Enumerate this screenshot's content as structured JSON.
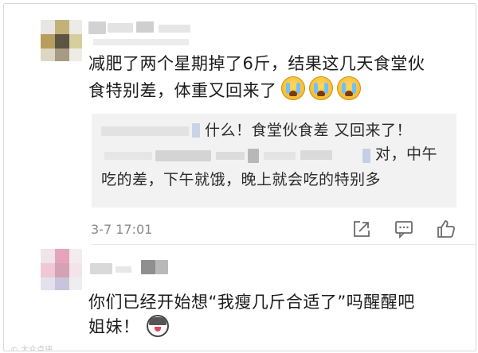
{
  "comment1": {
    "username_placeholder": "",
    "text_line1": "减肥了两个星期掉了6斤，结果这几天食堂伙",
    "text_line2": "食特别差，体重又回来了",
    "emojis": [
      "crying-face",
      "crying-face",
      "crying-face"
    ]
  },
  "reply": {
    "line1": "什么！食堂伙食差 又回来了！",
    "line2": "对，中午",
    "line3": "吃的差，下午就饿，晚上就会吃的特别多"
  },
  "meta": {
    "timestamp": "3-7 17:01"
  },
  "actions": [
    "share-icon",
    "comment-icon",
    "like-icon"
  ],
  "comment2": {
    "text_line1": "你们已经开始想“我瘦几斤合适了”吗醒醒吧",
    "text_line2": "姐妹！",
    "emoji": "husky-face"
  },
  "watermark": "© 大众点评"
}
